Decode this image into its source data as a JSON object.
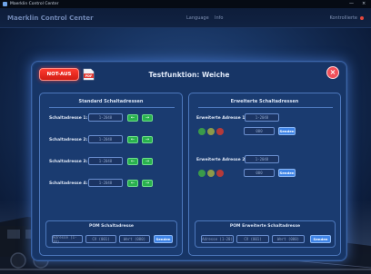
{
  "window": {
    "title": "Maerklin Control Center",
    "controls": [
      "—",
      "×"
    ]
  },
  "header": {
    "brand": "Maerklin Control Center",
    "nav": [
      "Language",
      "Info"
    ],
    "status_text": "Kontrollierte"
  },
  "dialog": {
    "title": "Testfunktion: Weiche",
    "notaus_label": "NOT-AUS",
    "close_label": "×",
    "pdf_label": "PDF"
  },
  "standard": {
    "title": "Standard Schaltadressen",
    "rows": [
      {
        "label": "Schaltadresse 1:",
        "placeholder": "1-2048",
        "btn_left": "←",
        "btn_right": "→"
      },
      {
        "label": "Schaltadresse 2:",
        "placeholder": "1-2048",
        "btn_left": "←",
        "btn_right": "→"
      },
      {
        "label": "Schaltadresse 3:",
        "placeholder": "1-2048",
        "btn_left": "←",
        "btn_right": "→"
      },
      {
        "label": "Schaltadresse 4:",
        "placeholder": "1-2048",
        "btn_left": "←",
        "btn_right": "→"
      }
    ],
    "pom": {
      "title": "POM Schaltadresse",
      "fields": [
        "Adresse (1-20)",
        "CV (001)",
        "Wert (000)"
      ],
      "button": "Senden"
    }
  },
  "extended": {
    "title": "Erweiterte Schaltadressen",
    "rows": [
      {
        "label": "Erweiterte Adresse 1:",
        "placeholder": "1-2048",
        "value_placeholder": "000",
        "button": "Senden",
        "leds": [
          "#3a9a4a",
          "#8c9a4a",
          "#b43a3a"
        ]
      },
      {
        "label": "Erweiterte Adresse 2:",
        "placeholder": "1-2048",
        "value_placeholder": "000",
        "button": "Senden",
        "leds": [
          "#3a9a4a",
          "#8c9a4a",
          "#b43a3a"
        ]
      }
    ],
    "pom": {
      "title": "POM Erweiterte Schaltadresse",
      "fields": [
        "Adresse (1-20)",
        "CV (001)",
        "Wert (000)"
      ],
      "button": "Senden"
    }
  },
  "colors": {
    "accent": "#3f84e6",
    "notaus": "#e8231a",
    "go": "#29b14e",
    "close": "#f0505a"
  }
}
